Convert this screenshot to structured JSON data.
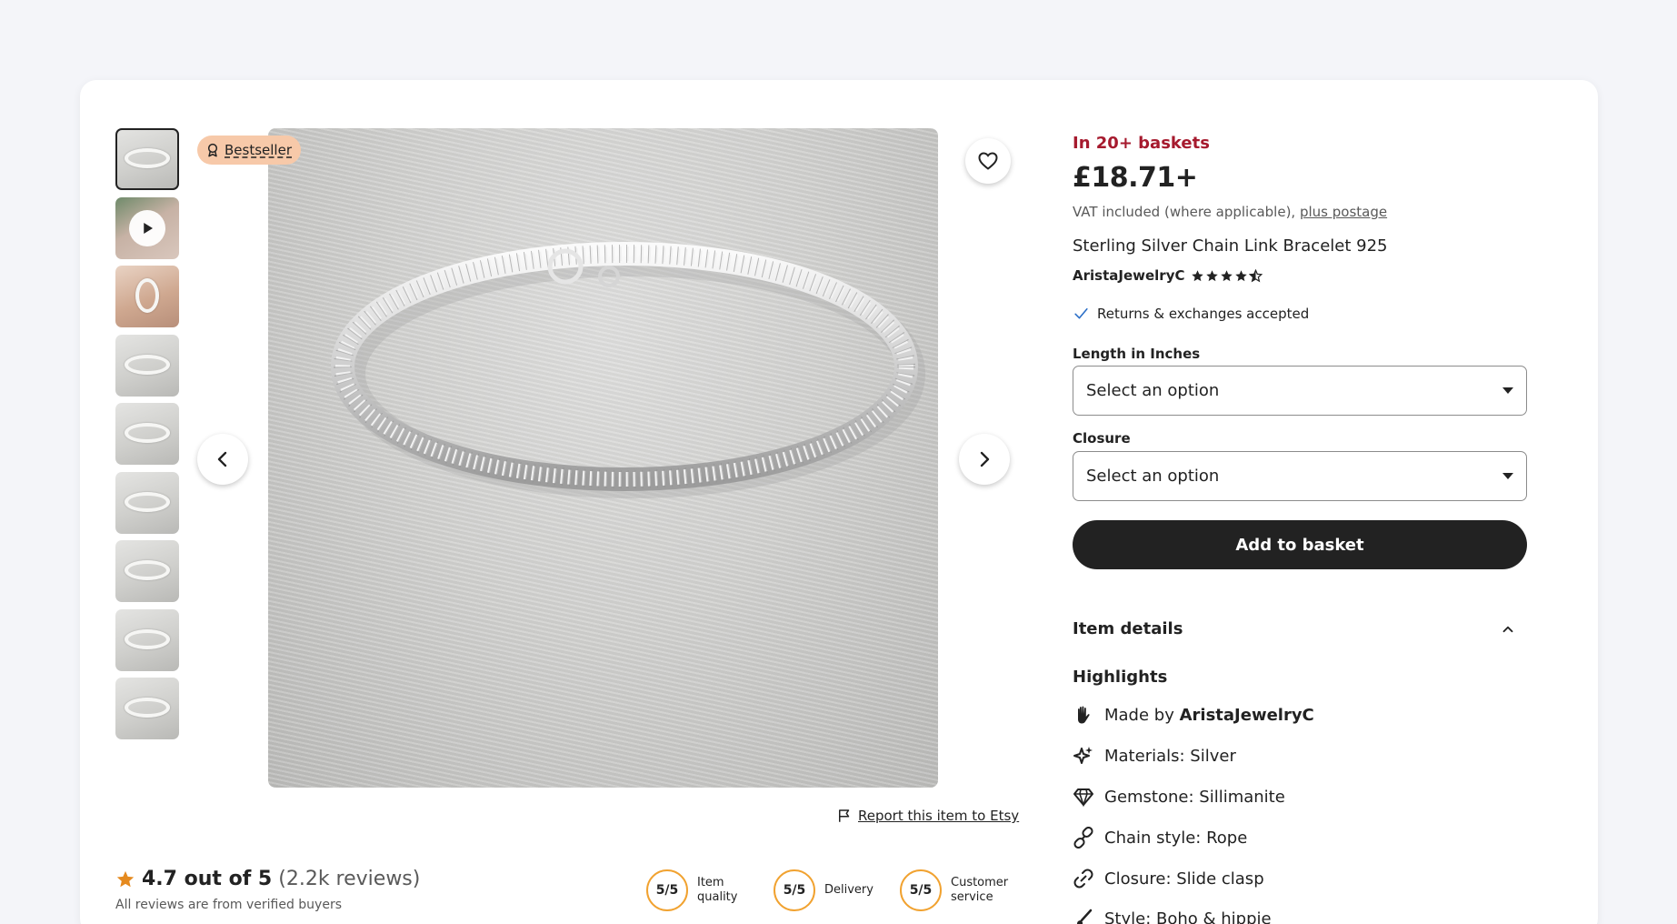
{
  "gallery": {
    "thumbnails": [
      {
        "kind": "image",
        "active": true
      },
      {
        "kind": "video"
      },
      {
        "kind": "wrist"
      },
      {
        "kind": "image"
      },
      {
        "kind": "image"
      },
      {
        "kind": "image"
      },
      {
        "kind": "image"
      },
      {
        "kind": "image"
      },
      {
        "kind": "image"
      }
    ],
    "badge_label": "Bestseller",
    "report_label": "Report this item to Etsy"
  },
  "reviews": {
    "score": "4.7 out of 5",
    "count": "(2.2k reviews)",
    "note": "All reviews are from verified buyers",
    "metrics": [
      {
        "value": "5/5",
        "label": "Item quality"
      },
      {
        "value": "5/5",
        "label": "Delivery"
      },
      {
        "value": "5/5",
        "label": "Customer service"
      }
    ]
  },
  "product": {
    "baskets": "In 20+ baskets",
    "price": "£18.71+",
    "vat_text": "VAT included (where applicable), ",
    "postage_link": "plus postage",
    "title": "Sterling Silver Chain Link Bracelet 925",
    "shop_name": "AristaJewelryC",
    "shop_rating": 4.5,
    "returns": "Returns & exchanges accepted"
  },
  "options": {
    "length_label": "Length in Inches",
    "length_value": "Select an option",
    "closure_label": "Closure",
    "closure_value": "Select an option",
    "add_label": "Add to basket"
  },
  "details": {
    "heading": "Item details",
    "highlights_heading": "Highlights",
    "made_by_prefix": "Made by ",
    "made_by_shop": "AristaJewelryC",
    "materials": "Materials: Silver",
    "gemstone": "Gemstone: Sillimanite",
    "chain_style": "Chain style: Rope",
    "closure": "Closure: Slide clasp",
    "style": "Style: Boho & hippie"
  },
  "colors": {
    "accent_red": "#a61a2e",
    "badge_bg": "#f7c9a9",
    "metric_ring": "#f1a230",
    "button_dark": "#222222"
  }
}
